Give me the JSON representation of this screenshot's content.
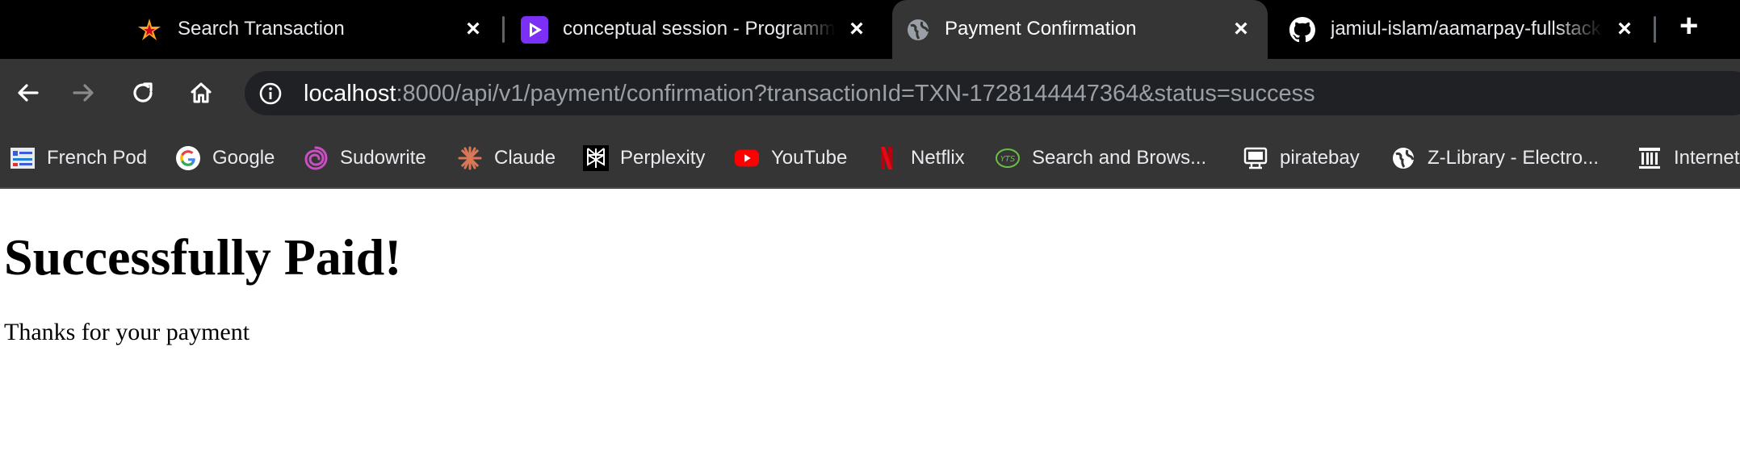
{
  "tabs": [
    {
      "title": "Search Transaction",
      "icon": "star-burst-icon",
      "active": false
    },
    {
      "title": "conceptual session - Programming Hero",
      "icon": "play-logo-icon",
      "active": false
    },
    {
      "title": "Payment Confirmation",
      "icon": "globe-icon",
      "active": true
    },
    {
      "title": "jamiul-islam/aamarpay-fullstack",
      "icon": "github-icon",
      "active": false
    }
  ],
  "new_tab_label": "+",
  "close_glyph": "×",
  "address_bar": {
    "host": "localhost",
    "rest": ":8000/api/v1/payment/confirmation?transactionId=TXN-1728144447364&status=success"
  },
  "bookmarks": [
    {
      "label": "French Pod",
      "icon": "frenchpod-icon"
    },
    {
      "label": "Google",
      "icon": "google-icon"
    },
    {
      "label": "Sudowrite",
      "icon": "sudowrite-icon"
    },
    {
      "label": "Claude",
      "icon": "claude-icon"
    },
    {
      "label": "Perplexity",
      "icon": "perplexity-icon"
    },
    {
      "label": "YouTube",
      "icon": "youtube-icon"
    },
    {
      "label": "Netflix",
      "icon": "netflix-icon"
    },
    {
      "label": "Search and Brows...",
      "icon": "yts-icon"
    },
    {
      "label": "piratebay",
      "icon": "piratebay-icon"
    },
    {
      "label": "Z-Library - Electro...",
      "icon": "globe-icon"
    },
    {
      "label": "Internet Archive",
      "icon": "archive-icon"
    }
  ],
  "page": {
    "heading": "Successfully Paid!",
    "message": "Thanks for your payment"
  },
  "colors": {
    "tabstrip_bg": "#000000",
    "toolbar_bg": "#353535",
    "omnibox_bg": "#202124",
    "url_dim": "#9aa0a6"
  }
}
